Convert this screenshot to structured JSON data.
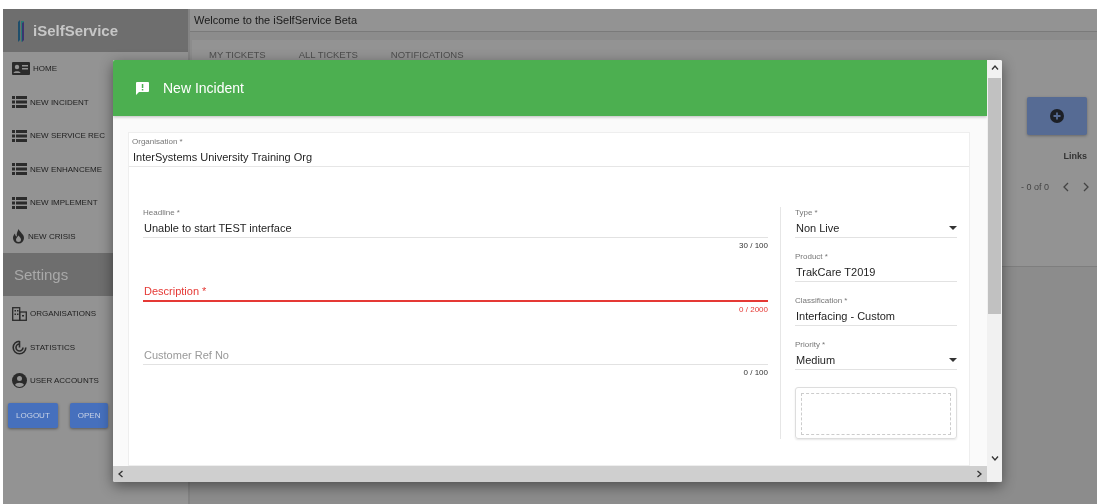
{
  "sidebar": {
    "brand": "iSelfService",
    "items": [
      {
        "label": "HOME"
      },
      {
        "label": "NEW INCIDENT"
      },
      {
        "label": "NEW SERVICE REC"
      },
      {
        "label": "NEW ENHANCEME"
      },
      {
        "label": "NEW IMPLEMENT"
      },
      {
        "label": "NEW CRISIS"
      }
    ],
    "settings_title": "Settings",
    "settings_items": [
      {
        "label": "ORGANISATIONS"
      },
      {
        "label": "STATISTICS"
      },
      {
        "label": "USER ACCOUNTS"
      }
    ],
    "buttons": [
      "LOGOUT",
      "OPEN"
    ]
  },
  "main": {
    "title": "Welcome to the iSelfService Beta",
    "tabs": [
      {
        "label": "MY TICKETS"
      },
      {
        "label": "ALL TICKETS"
      },
      {
        "label": "NOTIFICATIONS"
      }
    ],
    "column_header": "Links",
    "pager": "- 0 of 0"
  },
  "dialog": {
    "title": "New Incident",
    "organisation": {
      "label": "Organisation *",
      "value": "InterSystems University Training Org"
    },
    "fields": [
      {
        "label": "Headline *",
        "value": "Unable to start TEST interface",
        "counter": "30 / 100",
        "error": false
      },
      {
        "label": "Description *",
        "counter": "0 / 2000",
        "error": true
      },
      {
        "label": "Customer Ref No",
        "counter": "0 / 100",
        "error": false
      }
    ],
    "side_fields": [
      {
        "kind": "select",
        "label": "Type *",
        "value": "Non Live"
      },
      {
        "kind": "text",
        "label": "Product *",
        "value": "TrakCare T2019"
      },
      {
        "kind": "text",
        "label": "Classification *",
        "value": "Interfacing - Custom"
      },
      {
        "kind": "select",
        "label": "Priority *",
        "value": "Medium"
      }
    ]
  }
}
